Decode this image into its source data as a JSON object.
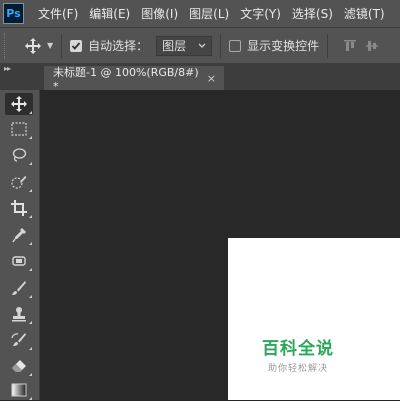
{
  "app": {
    "logo_text": "Ps"
  },
  "menu": [
    "文件(F)",
    "编辑(E)",
    "图像(I)",
    "图层(L)",
    "文字(Y)",
    "选择(S)",
    "滤镜(T)"
  ],
  "options": {
    "auto_select_label": "自动选择：",
    "auto_select_checked": true,
    "target_value": "图层",
    "show_transform_label": "显示变换控件",
    "show_transform_checked": false
  },
  "panel": {
    "collapse_glyph": "▸▸"
  },
  "document": {
    "tab_title": "未标题-1 @ 100%(RGB/8#) *",
    "close_glyph": "×"
  },
  "tools": [
    "move-tool",
    "marquee-tool",
    "lasso-tool",
    "quick-selection-tool",
    "crop-tool",
    "eyedropper-tool",
    "healing-brush-tool",
    "brush-tool",
    "clone-stamp-tool",
    "history-brush-tool",
    "eraser-tool",
    "gradient-tool"
  ],
  "watermark": {
    "title": "百科全说",
    "subtitle": "助你轻松解决"
  },
  "colors": {
    "ui_panel": "#535353",
    "canvas_bg": "#282828",
    "accent_blue": "#31a8ff",
    "watermark_green": "#2aa85a"
  }
}
